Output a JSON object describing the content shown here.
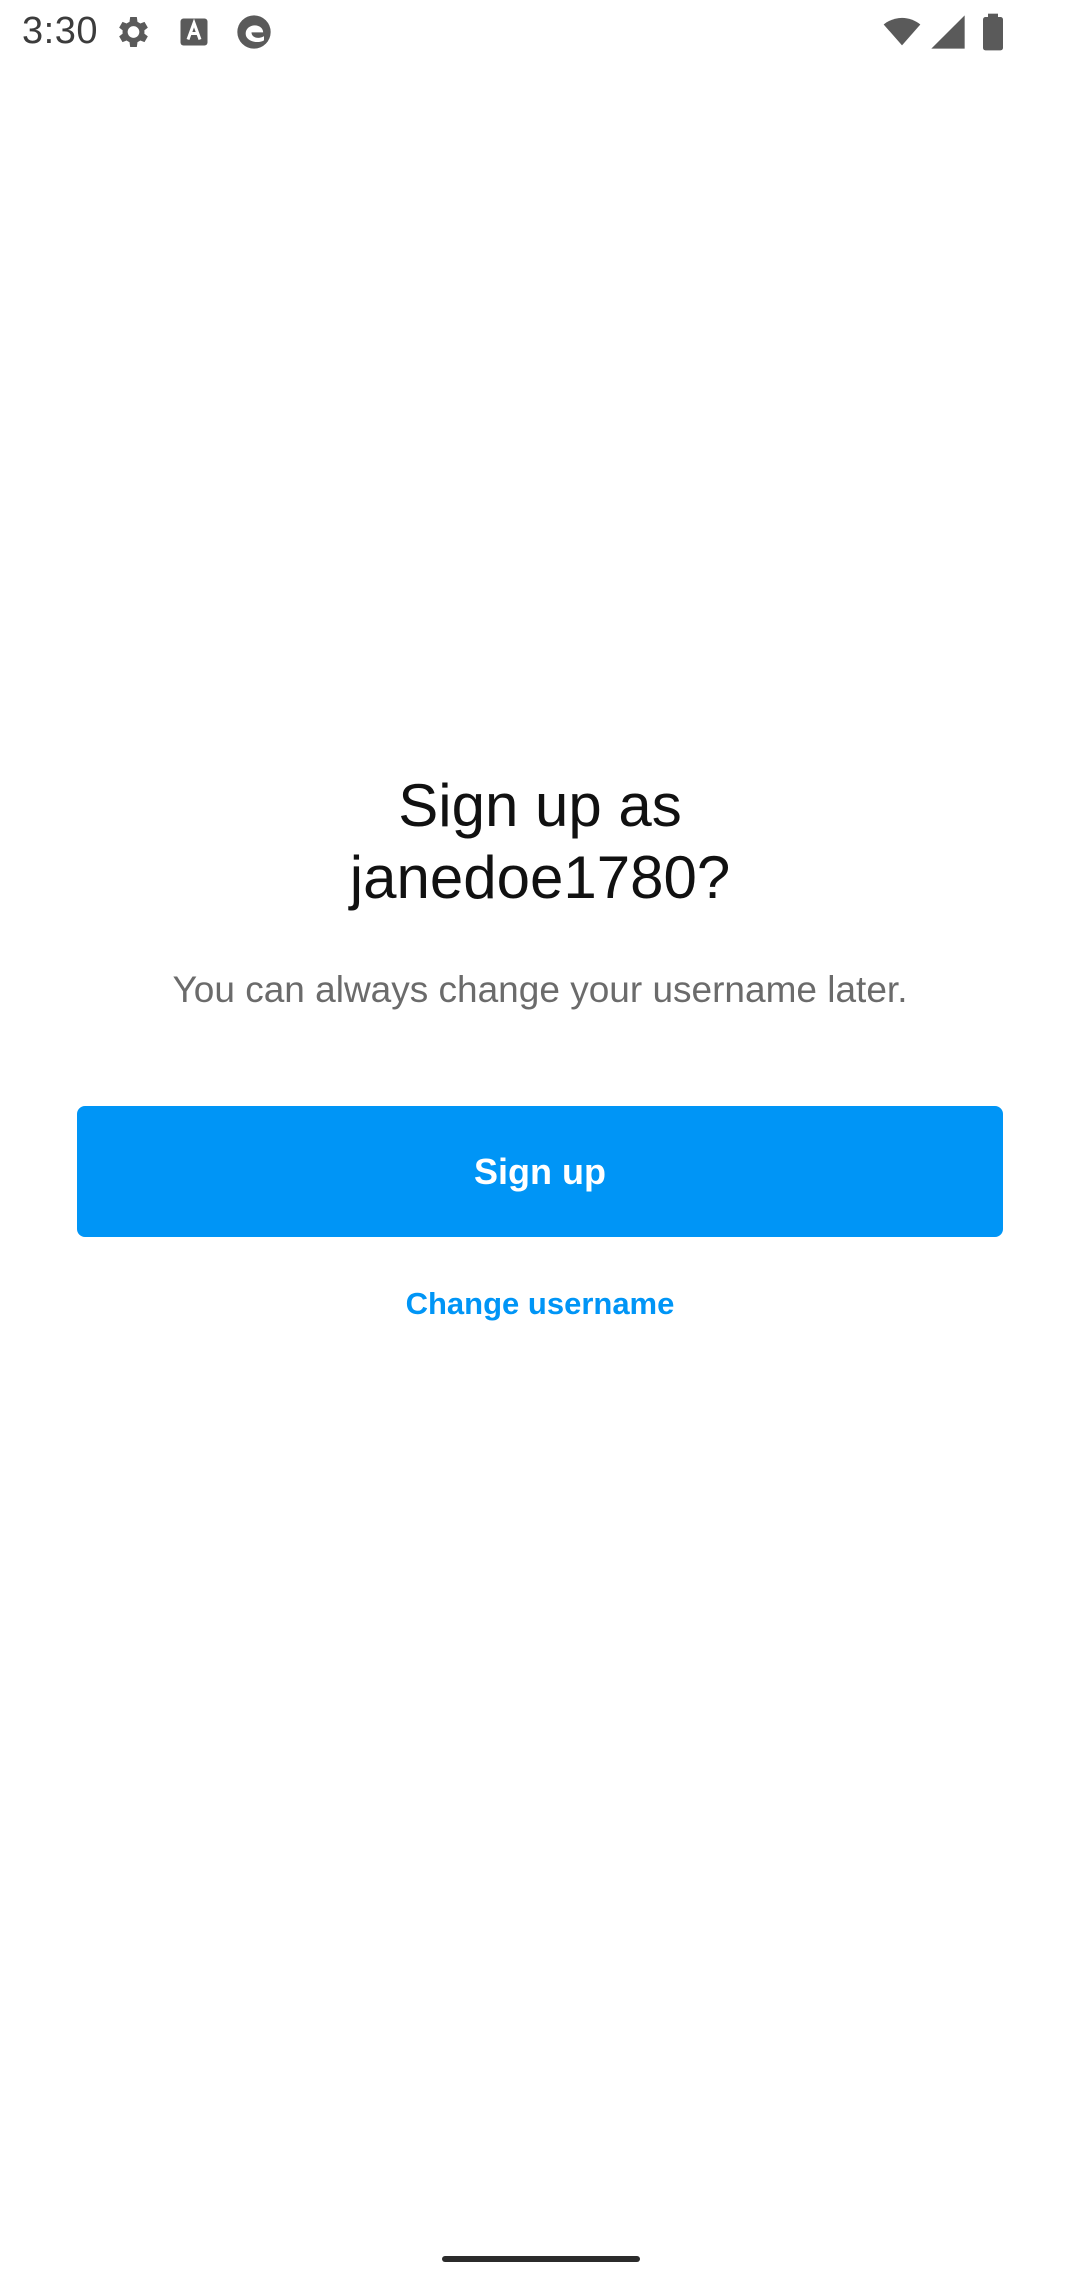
{
  "status_bar": {
    "time": "3:30",
    "icons": [
      "settings-icon",
      "text-a-icon",
      "edge-browser-icon",
      "wifi-icon",
      "cell-signal-icon",
      "battery-icon"
    ]
  },
  "main": {
    "title_line1": "Sign up as",
    "title_line2": "janedoe1780?",
    "subtitle": "You can always change your username later.",
    "signup_button_label": "Sign up",
    "change_username_label": "Change username"
  },
  "colors": {
    "accent": "#0095f6",
    "title_text": "#111111",
    "subtitle_text": "#6b6b6b",
    "background": "#ffffff"
  }
}
